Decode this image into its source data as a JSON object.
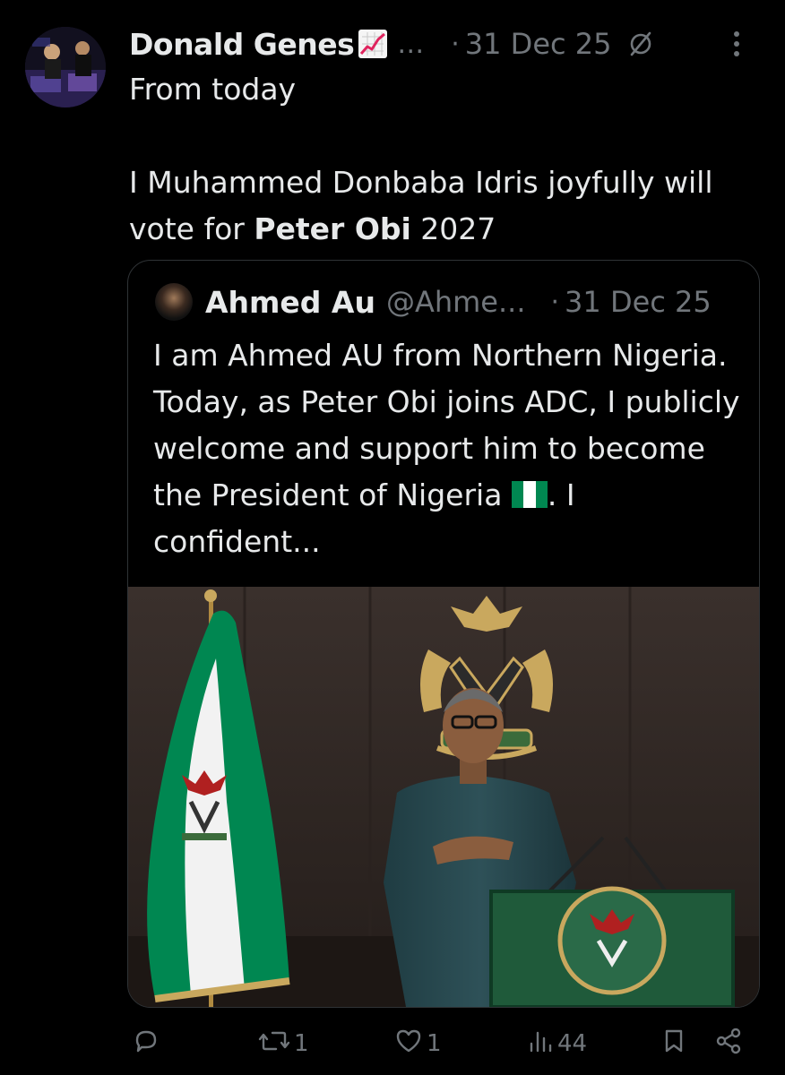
{
  "post": {
    "author_name": "Donald Genes",
    "author_emoji": "chart-increasing-icon",
    "truncation": "…",
    "separator": "·",
    "date": "31 Dec 25",
    "text_line1": "From today",
    "text_line2": "I Muhammed Donbaba Idris joyfully will vote for ",
    "text_bold": "Peter Obi",
    "text_tail": " 2027"
  },
  "quote": {
    "author_name": "Ahmed Au",
    "handle": "@Ahme...",
    "separator": "·",
    "date": "31 Dec 25",
    "text_before_flag": "I am Ahmed AU from Northern Nigeria. Today, as Peter Obi joins ADC, I publicly welcome and support him to become the President of Nigeria ",
    "flag_icon": "nigeria-flag-icon",
    "text_after_flag": ". I confident..."
  },
  "actions": {
    "replies": "",
    "reposts": "1",
    "likes": "1",
    "views": "44"
  },
  "colors": {
    "background": "#000000",
    "text": "#e7e9ea",
    "muted": "#71767b",
    "border": "#2f3336",
    "nigeria_green": "#008751"
  }
}
